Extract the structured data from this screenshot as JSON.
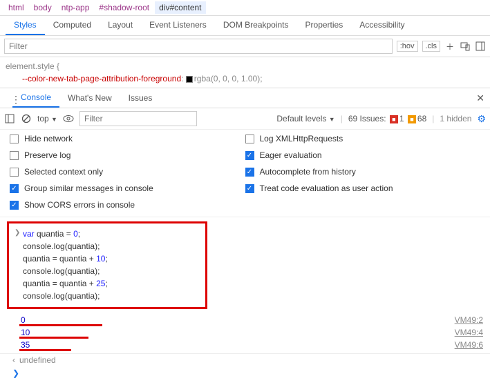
{
  "breadcrumb": [
    "html",
    "body",
    "ntp-app",
    "#shadow-root",
    "div#content"
  ],
  "elTabs": [
    "Styles",
    "Computed",
    "Layout",
    "Event Listeners",
    "DOM Breakpoints",
    "Properties",
    "Accessibility"
  ],
  "filter": {
    "placeholder": "Filter",
    "hov": ":hov",
    "cls": ".cls"
  },
  "styles": {
    "sel": "element.style {",
    "prop": "--color-new-tab-page-attribution-foreground",
    "val": "rgba(0, 0, 0, 1.00);"
  },
  "ctabs": [
    "Console",
    "What's New",
    "Issues"
  ],
  "ctb": {
    "top": "top",
    "filter": "Filter",
    "levels": "Default levels",
    "issues": "69 Issues:",
    "r": "1",
    "o": "68",
    "hidden": "1 hidden"
  },
  "checks": {
    "l": [
      {
        "t": "Hide network",
        "on": false
      },
      {
        "t": "Preserve log",
        "on": false
      },
      {
        "t": "Selected context only",
        "on": false
      },
      {
        "t": "Group similar messages in console",
        "on": true
      },
      {
        "t": "Show CORS errors in console",
        "on": true
      }
    ],
    "r": [
      {
        "t": "Log XMLHttpRequests",
        "on": false
      },
      {
        "t": "Eager evaluation",
        "on": true
      },
      {
        "t": "Autocomplete from history",
        "on": true
      },
      {
        "t": "Treat code evaluation as user action",
        "on": true
      }
    ]
  },
  "code": {
    "lines": [
      "var quantia = 0;",
      "console.log(quantia);",
      "quantia = quantia + 10;",
      "console.log(quantia);",
      "quantia = quantia + 25;",
      "console.log(quantia);"
    ]
  },
  "outputs": [
    {
      "v": "0",
      "src": "VM49:2",
      "u": 120
    },
    {
      "v": "10",
      "src": "VM49:4",
      "u": 100
    },
    {
      "v": "35",
      "src": "VM49:6",
      "u": 75
    }
  ],
  "undefined": "undefined"
}
